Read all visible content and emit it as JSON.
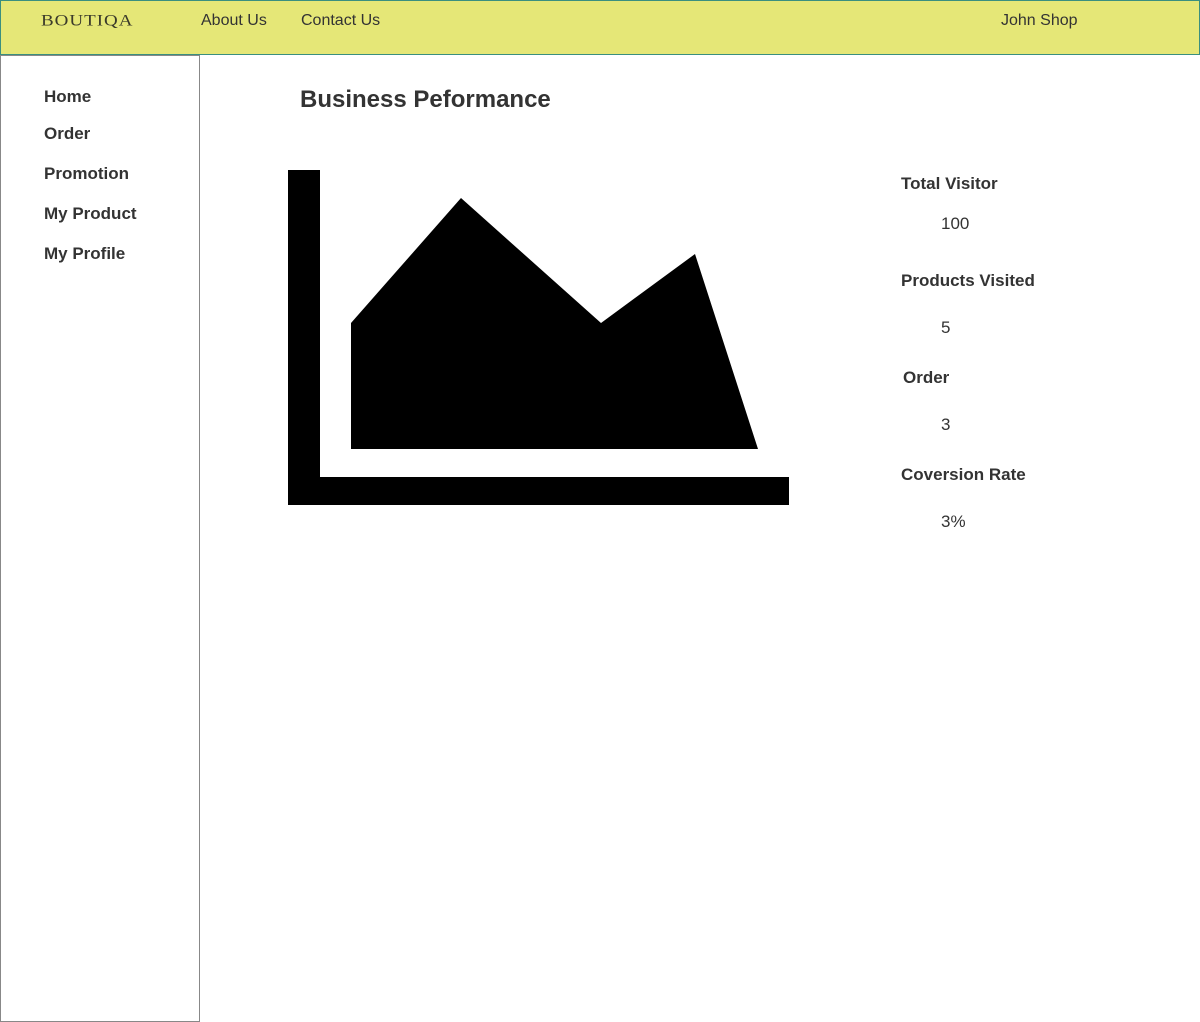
{
  "header": {
    "logo_text": "BOUTIQA",
    "nav": {
      "about": "About Us",
      "contact": "Contact Us"
    },
    "user_name": "John Shop"
  },
  "sidebar": {
    "items": [
      {
        "label": "Home"
      },
      {
        "label": "Order"
      },
      {
        "label": "Promotion"
      },
      {
        "label": "My Product"
      },
      {
        "label": "My Profile"
      }
    ]
  },
  "main": {
    "title": "Business Peformance",
    "chart_icon": "area-chart-icon",
    "stats": [
      {
        "label": "Total Visitor",
        "value": "100"
      },
      {
        "label": "Products Visited",
        "value": "5"
      },
      {
        "label": "Order",
        "value": "3"
      },
      {
        "label": "Coversion Rate",
        "value": "3%"
      }
    ]
  },
  "colors": {
    "header_bg": "#e5e777",
    "header_border": "#3a8f7f",
    "text": "#333333",
    "chart": "#000000"
  }
}
